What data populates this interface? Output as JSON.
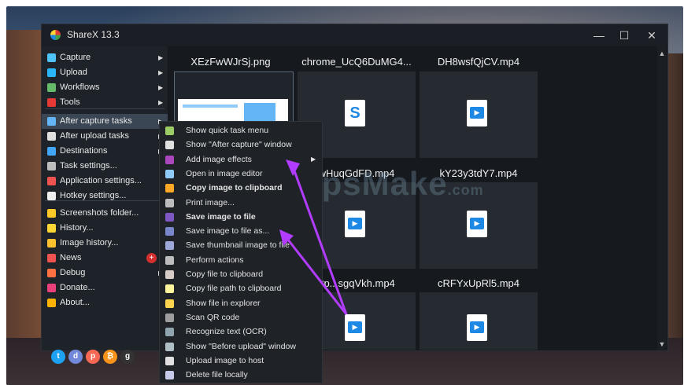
{
  "window": {
    "title": "ShareX 13.3",
    "minimize": "—",
    "maximize": "☐",
    "close": "✕"
  },
  "sidebar": {
    "items": [
      {
        "label": "Capture",
        "color": "#4fc3f7",
        "submenu": true
      },
      {
        "label": "Upload",
        "color": "#29b6f6",
        "submenu": true
      },
      {
        "label": "Workflows",
        "color": "#66bb6a",
        "submenu": true
      },
      {
        "label": "Tools",
        "color": "#e53935",
        "submenu": true
      },
      {
        "label": "After capture tasks",
        "color": "#64b5f6",
        "submenu": true,
        "active": true
      },
      {
        "label": "After upload tasks",
        "color": "#e0e0e0",
        "submenu": true
      },
      {
        "label": "Destinations",
        "color": "#42a5f5",
        "submenu": true
      },
      {
        "label": "Task settings...",
        "color": "#bdbdbd"
      },
      {
        "label": "Application settings...",
        "color": "#ef5350"
      },
      {
        "label": "Hotkey settings...",
        "color": "#eeeeee"
      },
      {
        "label": "Screenshots folder...",
        "color": "#ffca28"
      },
      {
        "label": "History...",
        "color": "#fdd835"
      },
      {
        "label": "Image history...",
        "color": "#fbc02d"
      },
      {
        "label": "News",
        "color": "#ef5350",
        "badge": "+"
      },
      {
        "label": "Debug",
        "color": "#ff7043",
        "submenu": true
      },
      {
        "label": "Donate...",
        "color": "#ec407a"
      },
      {
        "label": "About...",
        "color": "#ffb300"
      }
    ],
    "social": [
      {
        "name": "twitter-icon",
        "glyph": "t",
        "color": "#1da1f2"
      },
      {
        "name": "discord-icon",
        "glyph": "d",
        "color": "#7289da"
      },
      {
        "name": "patreon-icon",
        "glyph": "p",
        "color": "#f96854"
      },
      {
        "name": "bitcoin-icon",
        "glyph": "₿",
        "color": "#f7931a"
      },
      {
        "name": "github-icon",
        "glyph": "g",
        "color": "#333333"
      }
    ]
  },
  "files": {
    "row1": [
      "XEzFwWJrSj.png",
      "chrome_UcQ6DuMG4...",
      "DH8wsfQjCV.mp4"
    ],
    "row2": [
      "wHuqGdFD.mp4",
      "kY23y3tdY7.mp4"
    ],
    "row3": [
      "8p...sgqVkh.mp4",
      "cRFYxUpRl5.mp4"
    ]
  },
  "context_menu": {
    "items": [
      {
        "label": "Show quick task menu",
        "bold": false,
        "color": "#9ccc65"
      },
      {
        "label": "Show \"After capture\" window",
        "bold": false,
        "color": "#e0e0e0"
      },
      {
        "label": "Add image effects",
        "bold": false,
        "color": "#ab47bc",
        "submenu": true
      },
      {
        "label": "Open in image editor",
        "bold": false,
        "color": "#90caf9"
      },
      {
        "label": "Copy image to clipboard",
        "bold": true,
        "color": "#ffa726"
      },
      {
        "label": "Print image...",
        "bold": false,
        "color": "#bdbdbd"
      },
      {
        "label": "Save image to file",
        "bold": true,
        "color": "#7e57c2"
      },
      {
        "label": "Save image to file as...",
        "bold": false,
        "color": "#7986cb"
      },
      {
        "label": "Save thumbnail image to file",
        "bold": false,
        "color": "#9fa8da"
      },
      {
        "label": "Perform actions",
        "bold": false,
        "color": "#bdbdbd"
      },
      {
        "label": "Copy file to clipboard",
        "bold": false,
        "color": "#d7ccc8"
      },
      {
        "label": "Copy file path to clipboard",
        "bold": false,
        "color": "#fff59d"
      },
      {
        "label": "Show file in explorer",
        "bold": false,
        "color": "#ffd54f"
      },
      {
        "label": "Scan QR code",
        "bold": false,
        "color": "#9e9e9e"
      },
      {
        "label": "Recognize text (OCR)",
        "bold": false,
        "color": "#90a4ae"
      },
      {
        "label": "Show \"Before upload\" window",
        "bold": false,
        "color": "#b0bec5"
      },
      {
        "label": "Upload image to host",
        "bold": false,
        "color": "#e0e0e0"
      },
      {
        "label": "Delete file locally",
        "bold": false,
        "color": "#c5cae9"
      }
    ]
  },
  "watermark": "TipsMake",
  "watermark_suffix": ".com",
  "accent_colors": {
    "annotation_arrow": "#b23cff",
    "menu_active": "#3a4654"
  }
}
